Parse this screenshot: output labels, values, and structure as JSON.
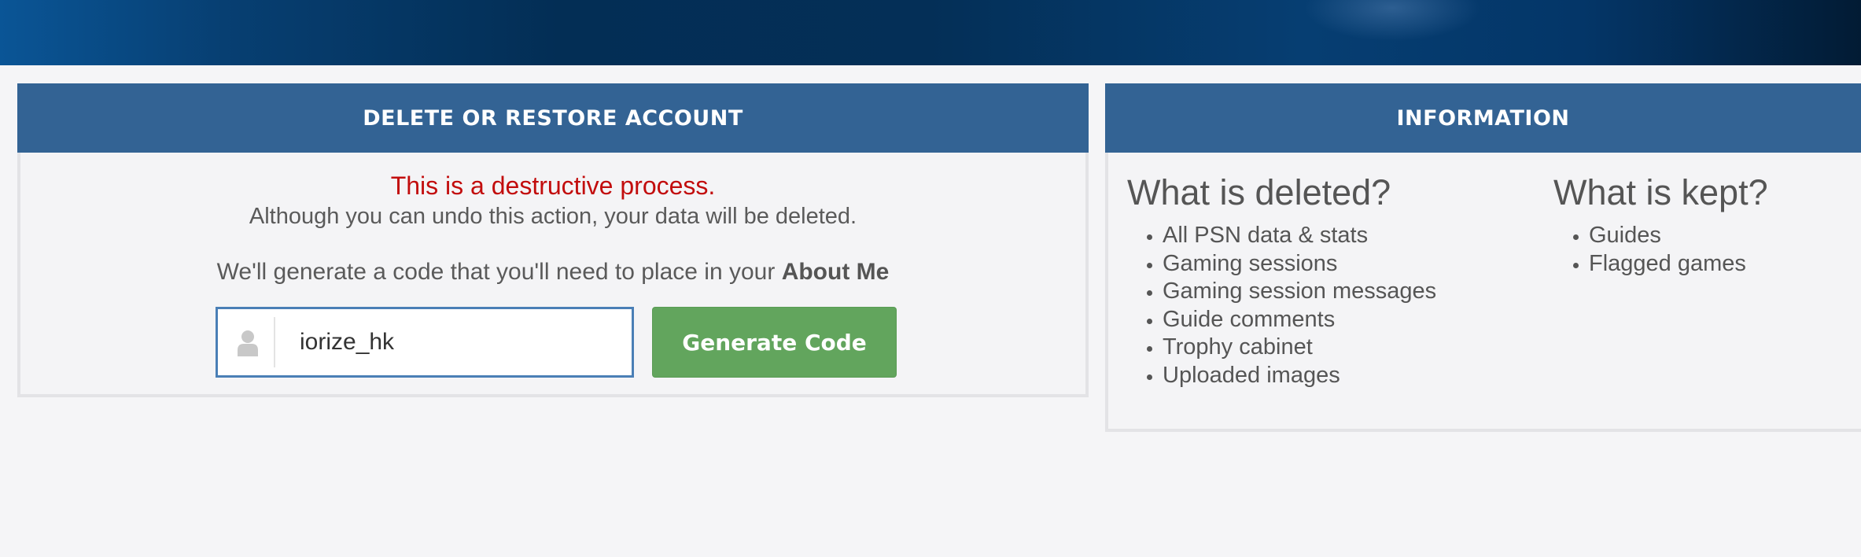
{
  "delete_panel": {
    "title": "DELETE OR RESTORE ACCOUNT",
    "warning": "This is a destructive process.",
    "subtext": "Although you can undo this action, your data will be deleted.",
    "code_text_prefix": "We'll generate a code that you'll need to place in your ",
    "code_text_bold": "About Me",
    "username_value": "iorize_hk",
    "user_icon": "user-icon",
    "generate_button_label": "Generate Code"
  },
  "info_panel": {
    "title": "INFORMATION",
    "deleted_heading": "What is deleted?",
    "deleted_items": [
      "All PSN data & stats",
      "Gaming sessions",
      "Gaming session messages",
      "Guide comments",
      "Trophy cabinet",
      "Uploaded images"
    ],
    "kept_heading": "What is kept?",
    "kept_items": [
      "Guides",
      "Flagged games"
    ]
  },
  "colors": {
    "header_blue": "#336394",
    "warning_red": "#c20d0d",
    "button_green": "#62a55d",
    "input_border": "#4a7fb6"
  }
}
